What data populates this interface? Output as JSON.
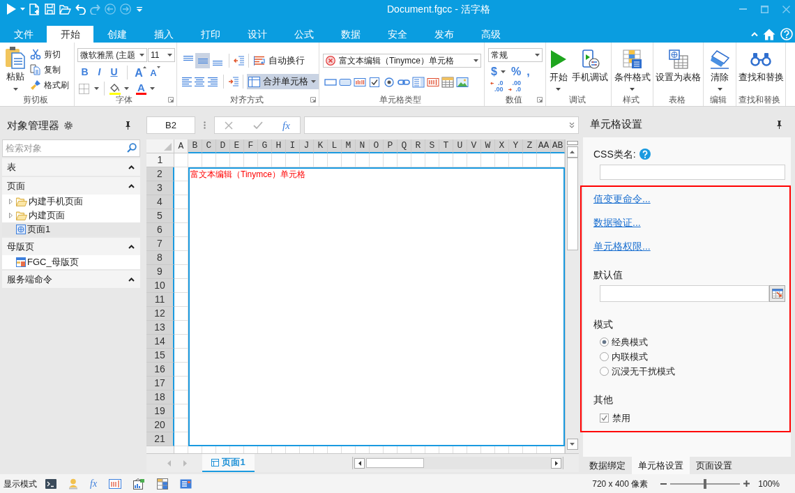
{
  "window": {
    "title": "Document.fgcc - 活字格"
  },
  "quick_access": [
    {
      "kind": "run",
      "disabled": false
    },
    {
      "kind": "new",
      "disabled": false
    },
    {
      "kind": "save",
      "disabled": false
    },
    {
      "kind": "open",
      "disabled": false
    },
    {
      "kind": "undo",
      "disabled": false
    },
    {
      "kind": "redo",
      "disabled": true
    },
    {
      "kind": "back",
      "disabled": true
    },
    {
      "kind": "forward",
      "disabled": true
    }
  ],
  "tabs": [
    {
      "label": "文件",
      "selected": false
    },
    {
      "label": "开始",
      "selected": true
    },
    {
      "label": "创建",
      "selected": false
    },
    {
      "label": "插入",
      "selected": false
    },
    {
      "label": "打印",
      "selected": false
    },
    {
      "label": "设计",
      "selected": false
    },
    {
      "label": "公式",
      "selected": false
    },
    {
      "label": "数据",
      "selected": false
    },
    {
      "label": "安全",
      "selected": false
    },
    {
      "label": "发布",
      "selected": false
    },
    {
      "label": "高级",
      "selected": false
    }
  ],
  "ribbon": {
    "clipboard": {
      "title": "剪切板",
      "paste": "粘贴",
      "actions": [
        {
          "kind": "cut",
          "label": "剪切"
        },
        {
          "kind": "copy",
          "label": "复制"
        },
        {
          "kind": "painter",
          "label": "格式刷"
        }
      ]
    },
    "font": {
      "title": "字体",
      "family": "微软雅黑 (主题",
      "size": "11",
      "styles": [
        {
          "kind": "bold",
          "label": "B"
        },
        {
          "kind": "italic",
          "label": "I"
        },
        {
          "kind": "underline",
          "label": "U"
        }
      ],
      "resize": [
        {
          "kind": "grow",
          "label": "A"
        },
        {
          "kind": "shrink",
          "label": "A"
        }
      ],
      "fill": {
        "color": "#ffff00"
      },
      "font_color": {
        "label": "A",
        "color": "#ff0000"
      }
    },
    "alignment": {
      "title": "对齐方式",
      "vertical": [
        {
          "kind": "top",
          "selected": false
        },
        {
          "kind": "middle",
          "selected": true
        },
        {
          "kind": "bottom",
          "selected": false
        }
      ],
      "horizontal": [
        {
          "kind": "left",
          "selected": false
        },
        {
          "kind": "center",
          "selected": false
        },
        {
          "kind": "right",
          "selected": false
        }
      ],
      "wrap_text": {
        "label": "自动换行",
        "selected": false
      },
      "merge_cells": {
        "label": "合并单元格",
        "selected": true
      }
    },
    "cell_type": {
      "title": "单元格类型",
      "current": "富文本编辑（Tinymce）单元格"
    },
    "number": {
      "title": "数值",
      "format": "常规",
      "symbols": [
        {
          "kind": "currency",
          "label": "$"
        },
        {
          "kind": "percent",
          "label": "%"
        },
        {
          "kind": "comma",
          "label": ","
        }
      ],
      "decimals": [
        {
          "kind": "increase",
          "top": ".0",
          "bottom": ".00"
        },
        {
          "kind": "decrease",
          "top": ".00",
          "bottom": ".0"
        }
      ]
    },
    "debug": {
      "title": "调试",
      "buttons": [
        {
          "kind": "start",
          "label": "开始",
          "menu": true
        },
        {
          "kind": "mobile",
          "label": "手机调试",
          "menu": false
        }
      ]
    },
    "style": {
      "title": "样式",
      "buttons": [
        {
          "kind": "conditional",
          "label": "条件格式",
          "menu": true
        }
      ]
    },
    "table": {
      "title": "表格",
      "buttons": [
        {
          "kind": "table",
          "label": "设置为表格",
          "menu": false
        }
      ]
    },
    "edit": {
      "title": "编辑",
      "buttons": [
        {
          "kind": "clear",
          "label": "清除",
          "menu": true
        }
      ]
    },
    "find": {
      "title": "查找和替换",
      "buttons": [
        {
          "kind": "find",
          "label": "查找和替换",
          "menu": false
        }
      ]
    }
  },
  "object_manager": {
    "title": "对象管理器",
    "search": {
      "placeholder": "检索对象"
    },
    "sections": [
      {
        "title": "表",
        "expanded": true
      },
      {
        "title": "页面",
        "expanded": true,
        "items": [
          {
            "kind": "folder",
            "label": "内建手机页面",
            "expanded": false,
            "selected": false
          },
          {
            "kind": "folder",
            "label": "内建页面",
            "expanded": false,
            "selected": false
          },
          {
            "kind": "page",
            "label": "页面1",
            "selected": true
          }
        ]
      },
      {
        "title": "母版页",
        "expanded": true,
        "items": [
          {
            "kind": "master",
            "label": "FGC_母版页",
            "selected": false
          }
        ]
      },
      {
        "title": "服务端命令",
        "expanded": true
      }
    ]
  },
  "formula_bar": {
    "cell": "B2",
    "editing": false,
    "function": "fx"
  },
  "sheet": {
    "columns": [
      {
        "label": "A",
        "selected": false
      },
      {
        "label": "B",
        "selected": true
      },
      {
        "label": "C",
        "selected": true
      },
      {
        "label": "D",
        "selected": true
      },
      {
        "label": "E",
        "selected": true
      },
      {
        "label": "F",
        "selected": true
      },
      {
        "label": "G",
        "selected": true
      },
      {
        "label": "H",
        "selected": true
      },
      {
        "label": "I",
        "selected": true
      },
      {
        "label": "J",
        "selected": true
      },
      {
        "label": "K",
        "selected": true
      },
      {
        "label": "L",
        "selected": true
      },
      {
        "label": "M",
        "selected": true
      },
      {
        "label": "N",
        "selected": true
      },
      {
        "label": "O",
        "selected": true
      },
      {
        "label": "P",
        "selected": true
      },
      {
        "label": "Q",
        "selected": true
      },
      {
        "label": "R",
        "selected": true
      },
      {
        "label": "S",
        "selected": true
      },
      {
        "label": "T",
        "selected": true
      },
      {
        "label": "U",
        "selected": true
      },
      {
        "label": "V",
        "selected": true
      },
      {
        "label": "W",
        "selected": true
      },
      {
        "label": "X",
        "selected": true
      },
      {
        "label": "Y",
        "selected": true
      },
      {
        "label": "Z",
        "selected": true
      },
      {
        "label": "AA",
        "selected": true
      },
      {
        "label": "AB",
        "selected": true
      }
    ],
    "rows": [
      {
        "label": "1",
        "selected": false
      },
      {
        "label": "2",
        "selected": true
      },
      {
        "label": "3",
        "selected": true
      },
      {
        "label": "4",
        "selected": true
      },
      {
        "label": "5",
        "selected": true
      },
      {
        "label": "6",
        "selected": true
      },
      {
        "label": "7",
        "selected": true
      },
      {
        "label": "8",
        "selected": true
      },
      {
        "label": "9",
        "selected": true
      },
      {
        "label": "10",
        "selected": true
      },
      {
        "label": "11",
        "selected": true
      },
      {
        "label": "12",
        "selected": true
      },
      {
        "label": "13",
        "selected": true
      },
      {
        "label": "14",
        "selected": true
      },
      {
        "label": "15",
        "selected": true
      },
      {
        "label": "16",
        "selected": true
      },
      {
        "label": "17",
        "selected": true
      },
      {
        "label": "18",
        "selected": true
      },
      {
        "label": "19",
        "selected": true
      },
      {
        "label": "20",
        "selected": true
      },
      {
        "label": "21",
        "selected": true
      }
    ],
    "cell_text": "富文本编辑（Tinymce）单元格",
    "tabs": [
      {
        "label": "页面1",
        "selected": true
      }
    ]
  },
  "cell_settings": {
    "title": "单元格设置",
    "css_class": {
      "label": "CSS类名:"
    },
    "links": [
      "值变更命令...",
      "数据验证...",
      "单元格权限..."
    ],
    "default_value": {
      "label": "默认值"
    },
    "mode": {
      "label": "模式",
      "options": [
        {
          "label": "经典模式",
          "selected": true
        },
        {
          "label": "内联模式",
          "selected": false
        },
        {
          "label": "沉浸无干扰模式",
          "selected": false
        }
      ]
    },
    "other": {
      "label": "其他",
      "options": [
        {
          "label": "禁用",
          "checked": true
        }
      ]
    },
    "tabs": [
      {
        "label": "数据绑定",
        "selected": false
      },
      {
        "label": "单元格设置",
        "selected": true
      },
      {
        "label": "页面设置",
        "selected": false
      }
    ]
  },
  "status_bar": {
    "mode": "显示模式",
    "formula_tool": "fx",
    "page_size": "720 x 400 像素",
    "zoom": {
      "level": 0.5,
      "reading": "100%"
    }
  }
}
